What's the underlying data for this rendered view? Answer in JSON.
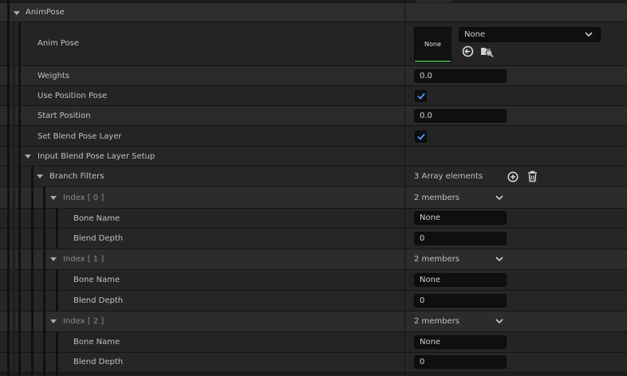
{
  "section_title": "AnimPose",
  "anim_pose": {
    "label": "Anim Pose",
    "thumbnail_text": "None",
    "dropdown_value": "None",
    "icons": [
      "use-selected-icon",
      "browse-icon"
    ]
  },
  "weights": {
    "label": "Weights",
    "value": "0.0"
  },
  "use_position_pose": {
    "label": "Use Position Pose",
    "checked": true
  },
  "start_position": {
    "label": "Start Position",
    "value": "0.0"
  },
  "set_blend_pose_layer": {
    "label": "Set Blend Pose Layer",
    "checked": true
  },
  "input_blend_setup": {
    "label": "Input Blend Pose Layer Setup"
  },
  "branch_filters": {
    "label": "Branch Filters",
    "summary": "3 Array elements",
    "items": [
      {
        "index_label": "Index [ 0 ]",
        "members": "2 members",
        "bone_label": "Bone Name",
        "bone_value": "None",
        "depth_label": "Blend Depth",
        "depth_value": "0"
      },
      {
        "index_label": "Index [ 1 ]",
        "members": "2 members",
        "bone_label": "Bone Name",
        "bone_value": "None",
        "depth_label": "Blend Depth",
        "depth_value": "0"
      },
      {
        "index_label": "Index [ 2 ]",
        "members": "2 members",
        "bone_label": "Bone Name",
        "bone_value": "None",
        "depth_label": "Blend Depth",
        "depth_value": "0"
      }
    ]
  }
}
